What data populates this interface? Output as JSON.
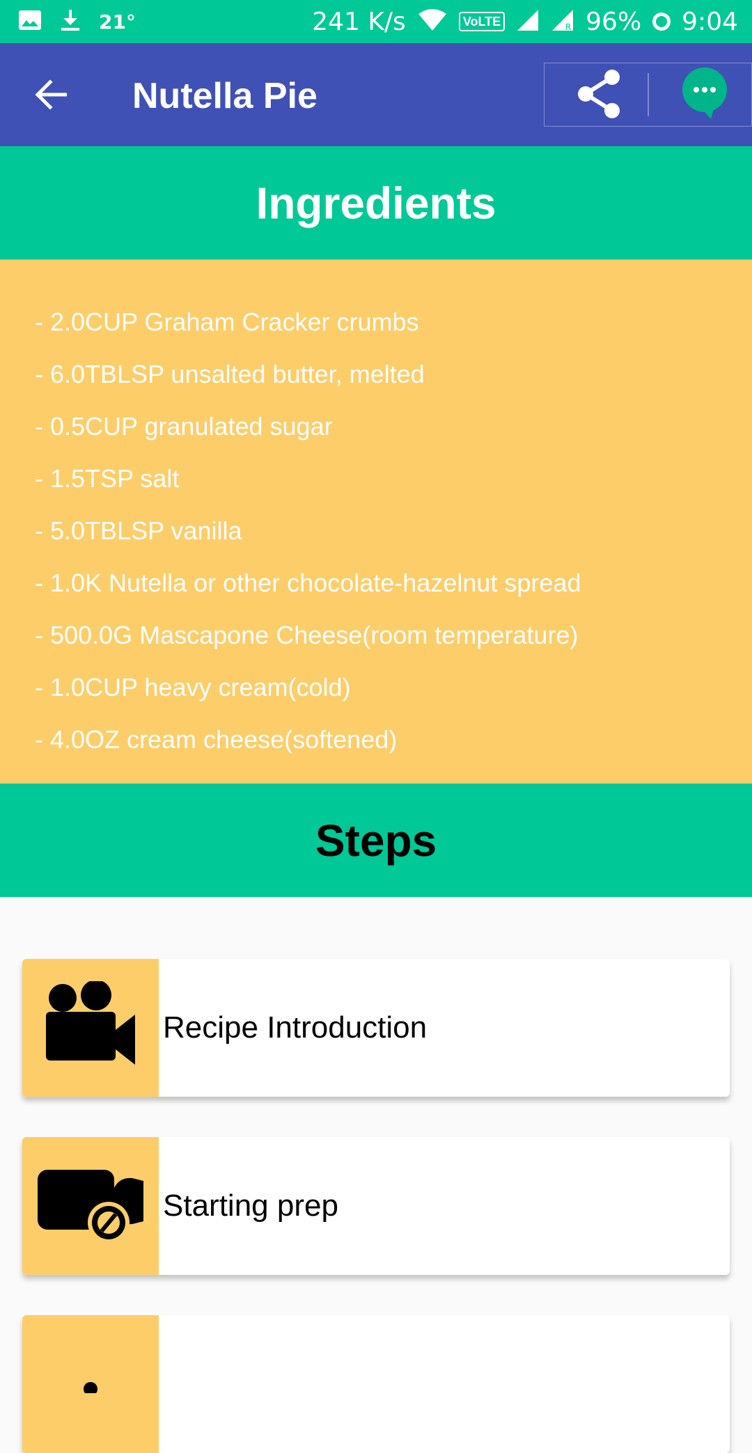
{
  "status_bar": {
    "temperature": "21°",
    "network_speed": "241 K/s",
    "volte": "VoLTE",
    "roaming": "R",
    "battery": "96%",
    "time": "9:04",
    "icons": [
      "image-icon",
      "download-icon",
      "wifi-icon",
      "volte-icon",
      "signal-icon",
      "signal-roaming-icon",
      "battery-ring-icon"
    ]
  },
  "app_bar": {
    "title": "Nutella Pie",
    "back_icon": "arrow-back-icon",
    "share_icon": "share-icon",
    "chat_icon": "chat-bubble-icon"
  },
  "ingredients_section": {
    "title": "Ingredients",
    "items": [
      "- 2.0CUP Graham Cracker crumbs",
      "- 6.0TBLSP unsalted butter, melted",
      "- 0.5CUP granulated sugar",
      "- 1.5TSP salt",
      "- 5.0TBLSP vanilla",
      "- 1.0K Nutella or other chocolate-hazelnut spread",
      "- 500.0G Mascapone Cheese(room temperature)",
      "- 1.0CUP heavy cream(cold)",
      "- 4.0OZ cream cheese(softened)"
    ]
  },
  "steps_section": {
    "title": "Steps",
    "steps": [
      {
        "label": "Recipe Introduction",
        "icon": "video-camera-icon"
      },
      {
        "label": "Starting prep",
        "icon": "video-off-icon"
      },
      {
        "label": "",
        "icon": "step-thumbnail"
      }
    ]
  },
  "colors": {
    "status_bar": "#00c896",
    "app_bar": "#3f51b5",
    "section_header": "#00c896",
    "ingredients_bg": "#fdcd6a",
    "thumb_bg": "#fdcd6a",
    "page_bg": "#fafafa"
  }
}
